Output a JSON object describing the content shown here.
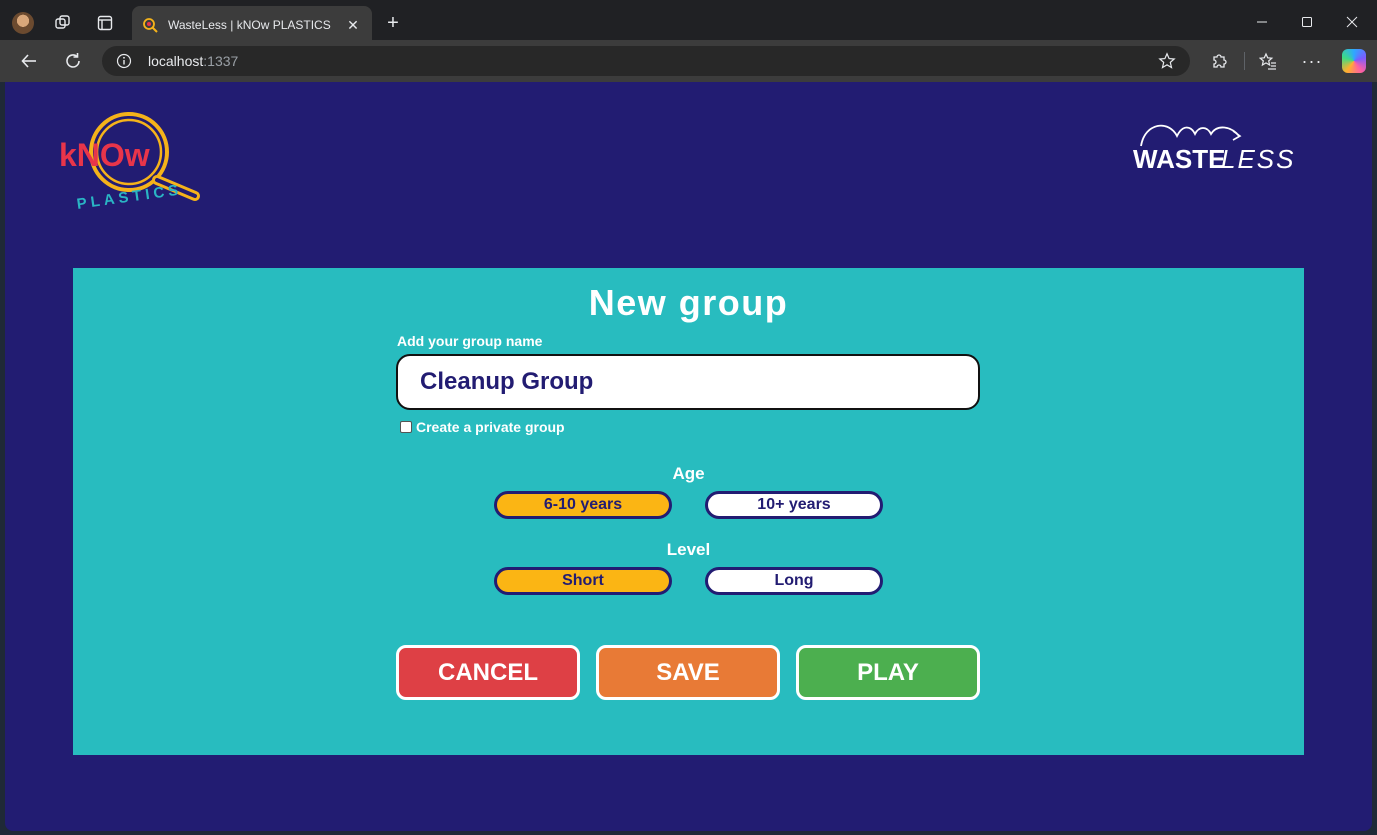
{
  "browser": {
    "tab_title": "WasteLess | kNOw PLASTICS",
    "url_host": "localhost",
    "url_port": ":1337"
  },
  "logos": {
    "know_word": "kNOw",
    "know_sub": "PLASTICS",
    "wasteless_bold": "WASTE",
    "wasteless_light": "LESS"
  },
  "form": {
    "title": "New group",
    "name_label": "Add your group name",
    "name_value": "Cleanup Group",
    "private_label": "Create a private group",
    "private_checked": false,
    "age": {
      "heading": "Age",
      "options": [
        {
          "label": "6-10 years",
          "selected": true
        },
        {
          "label": "10+ years",
          "selected": false
        }
      ]
    },
    "level": {
      "heading": "Level",
      "options": [
        {
          "label": "Short",
          "selected": true
        },
        {
          "label": "Long",
          "selected": false
        }
      ]
    },
    "actions": {
      "cancel": "CANCEL",
      "save": "SAVE",
      "play": "PLAY"
    }
  },
  "colors": {
    "page_bg": "#221c72",
    "panel_bg": "#28bcbf",
    "selected_pill": "#fbb514",
    "cancel": "#de4045",
    "save": "#e87a36",
    "play": "#4caf4f",
    "know_red": "#e8354a",
    "know_yellow": "#f5b31a",
    "know_teal": "#2ab5c4"
  }
}
